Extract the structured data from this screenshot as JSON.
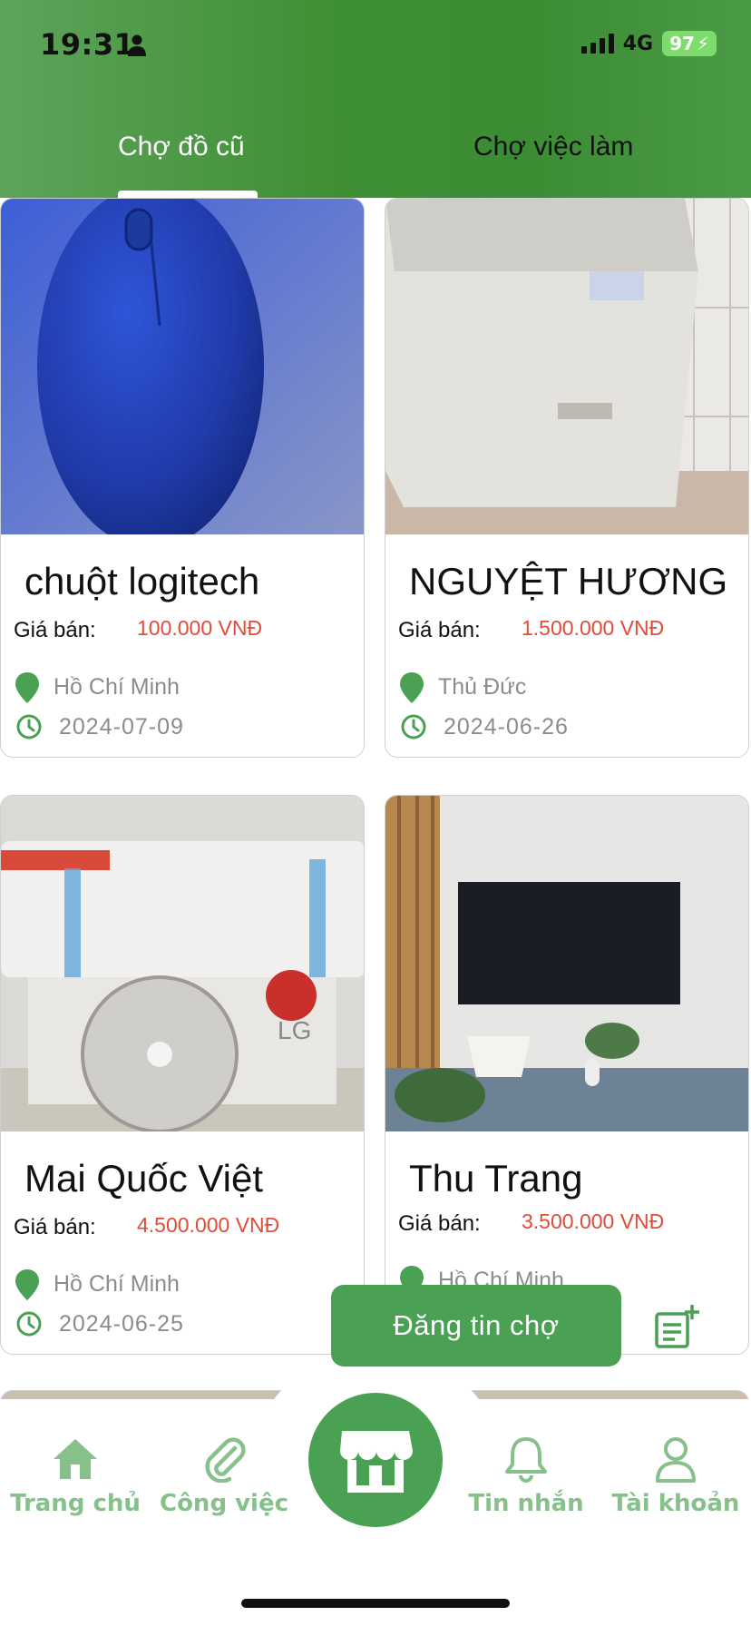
{
  "status_bar": {
    "time": "19:31",
    "network": "4G",
    "battery": "97"
  },
  "tabs": [
    {
      "label": "Chợ đồ cũ",
      "active": true
    },
    {
      "label": "Chợ việc làm",
      "active": false
    }
  ],
  "listing": {
    "price_label": "Giá bán:",
    "items": [
      {
        "title": "chuột logitech",
        "price": "100.000 VNĐ",
        "location": "Hồ Chí Minh",
        "date": "2024-07-09",
        "image": "blue-mouse-photo"
      },
      {
        "title": "NGUYỆT HƯƠNG",
        "price": "1.500.000 VNĐ",
        "location": "Thủ Đức",
        "date": "2024-06-26",
        "image": "washing-machine-photo"
      },
      {
        "title": "Mai Quốc Việt",
        "price": "4.500.000 VNĐ",
        "location": "Hồ Chí Minh",
        "date": "2024-06-25",
        "image": "air-conditioner-photo"
      },
      {
        "title": "Thu Trang",
        "price": "3.500.000 VNĐ",
        "location": "Hồ Chí Minh",
        "date": "",
        "image": "tv-photo"
      }
    ]
  },
  "post_button": {
    "label": "Đăng tin chợ"
  },
  "bottom_nav": {
    "items": [
      {
        "label": "Trang chủ",
        "icon": "home-icon"
      },
      {
        "label": "Công việc",
        "icon": "paperclip-icon"
      },
      {
        "label": "",
        "icon": "store-icon"
      },
      {
        "label": "Tin nhắn",
        "icon": "bell-icon"
      },
      {
        "label": "Tài khoản",
        "icon": "user-icon"
      }
    ]
  },
  "colors": {
    "primary": "#4aa154",
    "price": "#e04b3a",
    "nav_label": "#86c08a"
  }
}
